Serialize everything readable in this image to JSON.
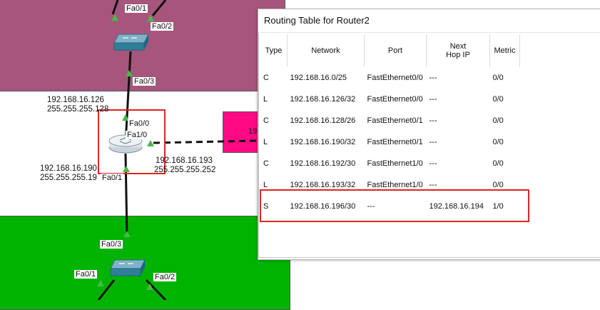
{
  "topology": {
    "top_switch_ports": {
      "fa01": "Fa0/1",
      "fa02": "Fa0/2",
      "fa03": "Fa0/3"
    },
    "bottom_switch_ports": {
      "fa01": "Fa0/1",
      "fa02": "Fa0/2",
      "fa03": "Fa0/3"
    },
    "router_ports": {
      "fa00": "Fa0/0",
      "fa10": "Fa1/0",
      "fa01": "Fa0/1"
    },
    "ip_labels": {
      "top_ip": "192.168.16.126",
      "top_mask": "255.255.255.128",
      "bottom_ip": "192.168.16.190",
      "bottom_mask": "255.255.255.19",
      "right_ip": "192.168.16.193",
      "right_mask": "255.255.255.252",
      "magenta_partial": "19"
    },
    "colors": {
      "top_region": "#a6567c",
      "bottom_region": "#00b300",
      "magenta_device": "#ff0a84",
      "highlight": "#e02424"
    }
  },
  "routing_window": {
    "title": "Routing Table for Router2",
    "headers": {
      "type": "Type",
      "network": "Network",
      "port": "Port",
      "next_hop_line1": "Next",
      "next_hop_line2": "Hop IP",
      "metric": "Metric"
    },
    "rows": [
      {
        "type": "C",
        "network": "192.168.16.0/25",
        "port": "FastEthernet0/0",
        "next_hop": "---",
        "metric": "0/0"
      },
      {
        "type": "L",
        "network": "192.168.16.126/32",
        "port": "FastEthernet0/0",
        "next_hop": "---",
        "metric": "0/0"
      },
      {
        "type": "C",
        "network": "192.168.16.128/26",
        "port": "FastEthernet0/1",
        "next_hop": "---",
        "metric": "0/0"
      },
      {
        "type": "L",
        "network": "192.168.16.190/32",
        "port": "FastEthernet0/1",
        "next_hop": "---",
        "metric": "0/0"
      },
      {
        "type": "C",
        "network": "192.168.16.192/30",
        "port": "FastEthernet1/0",
        "next_hop": "---",
        "metric": "0/0"
      },
      {
        "type": "L",
        "network": "192.168.16.193/32",
        "port": "FastEthernet1/0",
        "next_hop": "---",
        "metric": "0/0"
      },
      {
        "type": "S",
        "network": "192.168.16.196/30",
        "port": "---",
        "next_hop": "192.168.16.194",
        "metric": "1/0"
      }
    ]
  }
}
